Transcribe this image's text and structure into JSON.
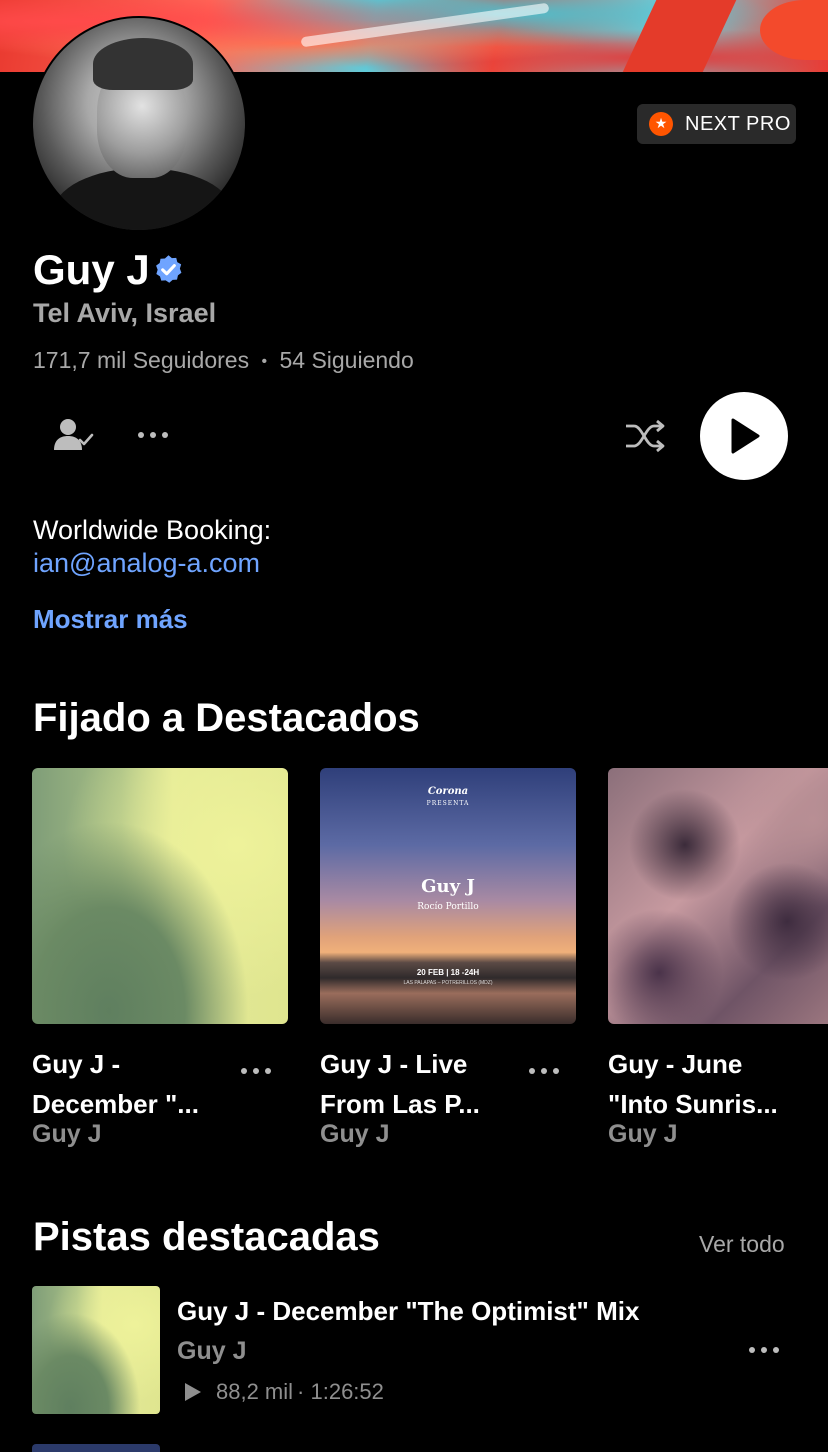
{
  "profile": {
    "name": "Guy J",
    "location": "Tel Aviv, Israel",
    "followers": "171,7 mil Seguidores",
    "stats_separator": "•",
    "following": "54 Siguiendo",
    "badge": "NEXT PRO",
    "bio_line1": "Worldwide Booking:",
    "bio_email": "ian@analog-a.com",
    "show_more": "Mostrar más"
  },
  "colors": {
    "accent_link": "#6fa4ff",
    "verified": "#6fa4ff",
    "next_pro": "#ff5500",
    "background": "#000000",
    "secondary_text": "#a8a8a8"
  },
  "icons": [
    "follow-icon",
    "more-icon",
    "shuffle-icon",
    "play-icon",
    "verified-icon",
    "star-icon"
  ],
  "pinned": {
    "title": "Fijado a Destacados",
    "items": [
      {
        "title": "Guy J -\nDecember \"...",
        "artist": "Guy J"
      },
      {
        "title": "Guy J - Live\nFrom Las P...",
        "artist": "Guy J",
        "art_top": "Corona",
        "art_sub": "PRESENTA",
        "art_title": "Guy J",
        "art_subtitle": "Rocío Portillo",
        "art_date": "20 FEB | 18 -24H",
        "art_place": "LAS PALAPAS – POTRERILLOS (MDZ)"
      },
      {
        "title": "Guy - June\n\"Into Sunris...",
        "artist": "Guy J"
      }
    ]
  },
  "featured": {
    "title": "Pistas destacadas",
    "see_all": "Ver todo",
    "tracks": [
      {
        "title": "Guy J - December \"The Optimist\" Mix",
        "artist": "Guy J",
        "plays": "88,2 mil",
        "duration": "· 1:26:52"
      }
    ]
  }
}
